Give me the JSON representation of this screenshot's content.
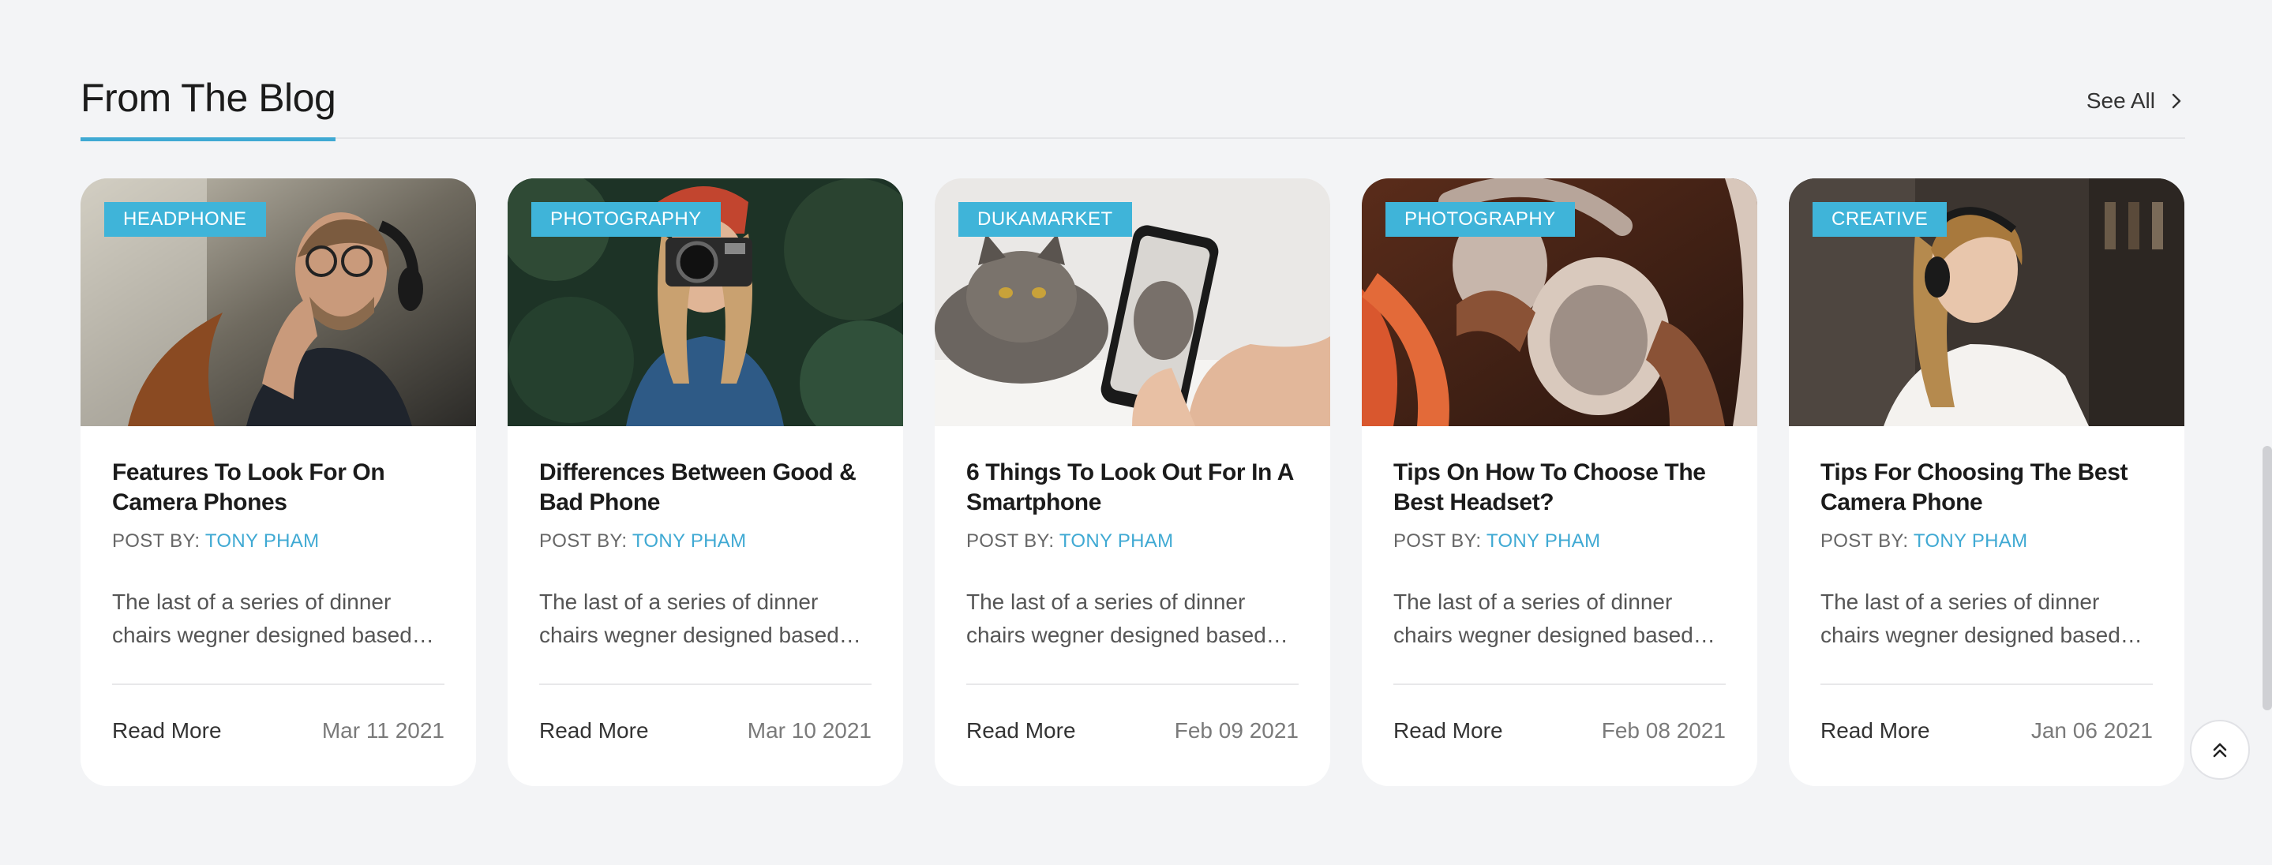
{
  "section": {
    "title": "From The Blog",
    "see_all": "See All"
  },
  "byline_prefix": "POST BY: ",
  "read_more": "Read More",
  "colors": {
    "accent": "#3fa9d3",
    "tag_bg": "#3fb4d9"
  },
  "posts": [
    {
      "tag": "HEADPHONE",
      "title_line1": "Features To Look For On",
      "title_line2": "Camera Phones",
      "author": "TONY PHAM",
      "excerpt_line1": "The last of a series of dinner",
      "excerpt_line2": "chairs wegner designed based…",
      "date": "Mar 11 2021",
      "image": "man-with-headphones"
    },
    {
      "tag": "PHOTOGRAPHY",
      "title_line1": "Differences Between Good &",
      "title_line2": "Bad Phone",
      "author": "TONY PHAM",
      "excerpt_line1": "The last of a series of dinner",
      "excerpt_line2": "chairs wegner designed based…",
      "date": "Mar 10 2021",
      "image": "woman-with-camera"
    },
    {
      "tag": "DUKAMARKET",
      "title_line1": "6 Things To Look Out For In A",
      "title_line2": "Smartphone",
      "author": "TONY PHAM",
      "excerpt_line1": "The last of a series of dinner",
      "excerpt_line2": "chairs wegner designed based…",
      "date": "Feb 09 2021",
      "image": "cat-and-smartphone"
    },
    {
      "tag": "PHOTOGRAPHY",
      "title_line1": "Tips On How To Choose The",
      "title_line2": "Best Headset?",
      "author": "TONY PHAM",
      "excerpt_line1": "The last of a series of dinner",
      "excerpt_line2": "chairs wegner designed based…",
      "date": "Feb 08 2021",
      "image": "hands-holding-headset"
    },
    {
      "tag": "CREATIVE",
      "title_line1": "Tips For Choosing The Best",
      "title_line2": "Camera Phone",
      "author": "TONY PHAM",
      "excerpt_line1": "The last of a series of dinner",
      "excerpt_line2": "chairs wegner designed based…",
      "date": "Jan 06 2021",
      "image": "woman-with-headphones"
    }
  ]
}
